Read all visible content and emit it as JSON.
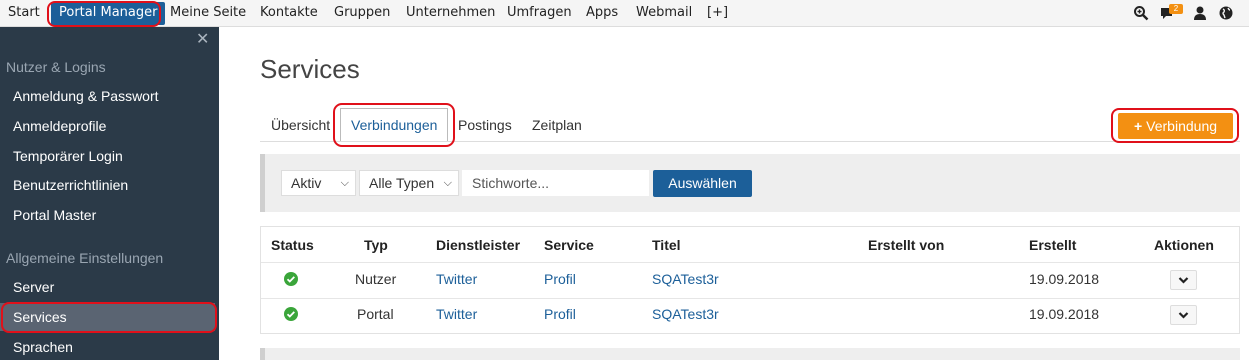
{
  "topnav": {
    "items": [
      "Start",
      "Portal Manager",
      "Meine Seite",
      "Kontakte",
      "Gruppen",
      "Unternehmen",
      "Umfragen",
      "Apps",
      "Webmail",
      "[+]"
    ],
    "active_index": 1,
    "notification_count": "2",
    "icons": [
      "search-zoom-icon",
      "chat-bubble-icon",
      "user-icon",
      "globe-icon"
    ]
  },
  "sidebar": {
    "close_glyph": "✕",
    "section1": "Nutzer & Logins",
    "items1": [
      "Anmeldung & Passwort",
      "Anmeldeprofile",
      "Temporärer Login",
      "Benutzerrichtlinien",
      "Portal Master"
    ],
    "section2": "Allgemeine Einstellungen",
    "items2": [
      "Server",
      "Services",
      "Sprachen"
    ],
    "active_item": "Services"
  },
  "page": {
    "title": "Services",
    "tabs": [
      "Übersicht",
      "Verbindungen",
      "Postings",
      "Zeitplan"
    ],
    "active_tab": "Verbindungen",
    "add_button": "Verbindung",
    "add_button_icon": "+"
  },
  "filters": {
    "status_select": "Aktiv",
    "type_select": "Alle Typen",
    "keyword_placeholder": "Stichworte...",
    "submit": "Auswählen"
  },
  "table": {
    "headers": [
      "Status",
      "Typ",
      "Dienstleister",
      "Service",
      "Titel",
      "Erstellt von",
      "Erstellt",
      "Aktionen"
    ],
    "rows": [
      {
        "status": "active",
        "typ": "Nutzer",
        "dienstleister": "Twitter",
        "service": "Profil",
        "titel": "SQATest3r",
        "erstellt_von": "",
        "erstellt": "19.09.2018"
      },
      {
        "status": "active",
        "typ": "Portal",
        "dienstleister": "Twitter",
        "service": "Profil",
        "titel": "SQATest3r",
        "erstellt_von": "",
        "erstellt": "19.09.2018"
      }
    ]
  },
  "colors": {
    "brand_blue": "#1c5f99",
    "accent_orange": "#f39012",
    "highlight_red": "#e0101a",
    "sidebar_bg": "#2b3a48",
    "ok_green": "#3aa53a"
  }
}
